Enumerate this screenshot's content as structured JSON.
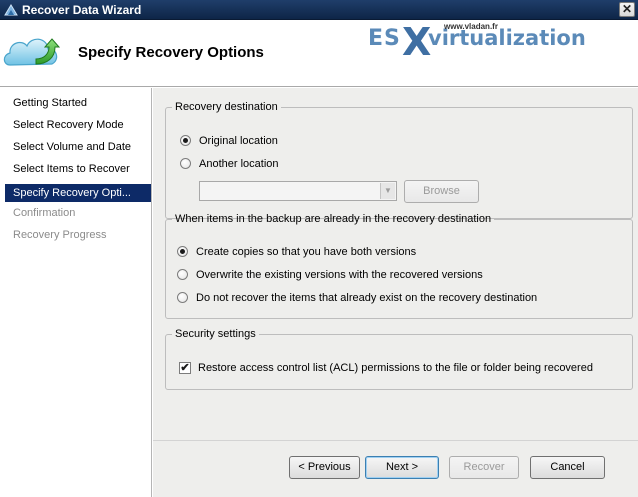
{
  "window": {
    "title": "Recover Data Wizard",
    "close_glyph": "✕",
    "app_icon": "server-backup-icon"
  },
  "header": {
    "page_title": "Specify Recovery Options",
    "wizard_icon": "cloud-recover-icon",
    "watermark": {
      "es": "ES",
      "x": "X",
      "word": "virtualization",
      "url": "www.vladan.fr"
    }
  },
  "sidebar": {
    "items": [
      {
        "label": "Getting Started",
        "state": "normal"
      },
      {
        "label": "Select Recovery Mode",
        "state": "normal"
      },
      {
        "label": "Select Volume and Date",
        "state": "normal"
      },
      {
        "label": "Select Items to Recover",
        "state": "normal"
      },
      {
        "label": "Specify Recovery Opti...",
        "state": "active"
      },
      {
        "label": "Confirmation",
        "state": "disabled"
      },
      {
        "label": "Recovery Progress",
        "state": "disabled"
      }
    ]
  },
  "recovery_destination": {
    "legend": "Recovery destination",
    "options": [
      {
        "label": "Original location",
        "checked": true
      },
      {
        "label": "Another location",
        "checked": false
      }
    ],
    "location_value": "",
    "browse_label": "Browse"
  },
  "conflict_handling": {
    "legend": "When items in the backup are already in the recovery destination",
    "options": [
      {
        "label": "Create copies so that you have both versions",
        "checked": true
      },
      {
        "label": "Overwrite the existing versions with the recovered versions",
        "checked": false
      },
      {
        "label": "Do not recover the items that already exist on the recovery destination",
        "checked": false
      }
    ]
  },
  "security": {
    "legend": "Security settings",
    "acl_label": "Restore access control list (ACL) permissions to the file or folder being recovered",
    "acl_checked": true,
    "check_glyph": "✔"
  },
  "footer": {
    "previous_label": "< Previous",
    "next_label": "Next >",
    "recover_label": "Recover",
    "cancel_label": "Cancel"
  },
  "colors": {
    "title_bar": "#1f3e6a",
    "nav_active": "#0d2a67",
    "panel_bg": "#eeeeec",
    "brand_blue": "#5b8ab8"
  }
}
